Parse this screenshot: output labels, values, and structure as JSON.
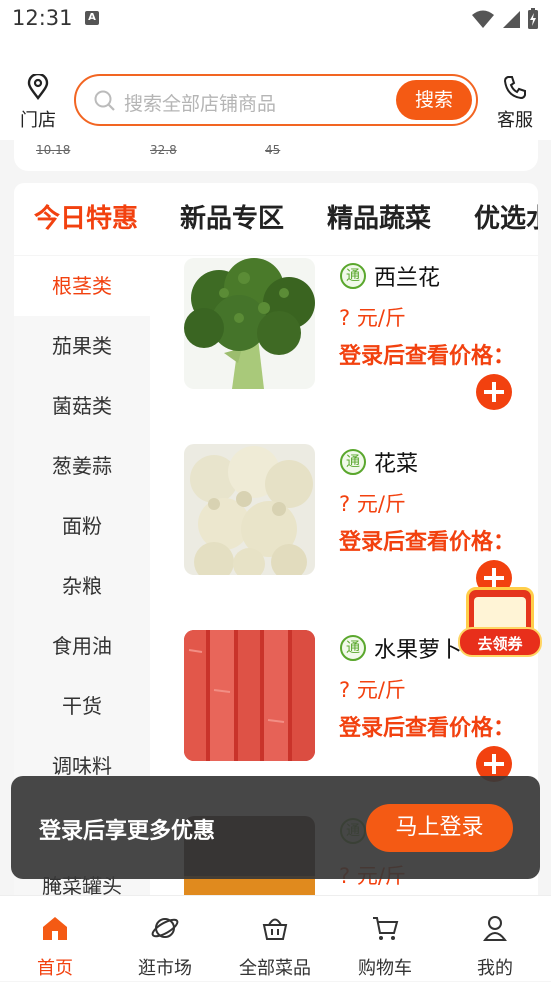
{
  "status_bar": {
    "time": "12:31",
    "a_badge": "A"
  },
  "header": {
    "store_label": "门店",
    "search_placeholder": "搜索全部店铺商品",
    "search_button": "搜索",
    "service_label": "客服"
  },
  "previous_prices": [
    "10.18",
    "32.8",
    "45"
  ],
  "tabs": [
    "今日特惠",
    "新品专区",
    "精品蔬菜",
    "优选水"
  ],
  "categories": [
    {
      "label": "根茎类",
      "active": true
    },
    {
      "label": "茄果类"
    },
    {
      "label": "菌菇类"
    },
    {
      "label": "葱姜蒜"
    },
    {
      "label": "面粉"
    },
    {
      "label": "杂粮"
    },
    {
      "label": "食用油"
    },
    {
      "label": "干货"
    },
    {
      "label": "调味料"
    },
    {
      "label": "腌菜罐头"
    }
  ],
  "products": [
    {
      "tag": "通",
      "name": "西兰花",
      "price": "? 元/斤",
      "login_hint": "登录后查看价格：",
      "image": "broccoli-image"
    },
    {
      "tag": "通",
      "name": "花菜",
      "price": "? 元/斤",
      "login_hint": "登录后查看价格：",
      "image": "cauliflower-image"
    },
    {
      "tag": "通",
      "name": "水果萝卜",
      "price": "? 元/斤",
      "login_hint": "登录后查看价格：",
      "image": "carrot-image"
    },
    {
      "tag": "通",
      "name": "",
      "price": "? 元/斤",
      "login_hint": "",
      "image": "dark-vegetable-image"
    }
  ],
  "coupon": {
    "label": "去领券"
  },
  "toast": {
    "message": "登录后享更多优惠",
    "button": "马上登录"
  },
  "bottom_nav": [
    {
      "label": "首页",
      "icon": "home-icon",
      "active": true
    },
    {
      "label": "逛市场",
      "icon": "planet-icon"
    },
    {
      "label": "全部菜品",
      "icon": "basket-icon"
    },
    {
      "label": "购物车",
      "icon": "cart-icon"
    },
    {
      "label": "我的",
      "icon": "user-icon"
    }
  ],
  "colors": {
    "accent": "#f2410f",
    "button": "#f45a14",
    "toast_bg": "#373737"
  }
}
